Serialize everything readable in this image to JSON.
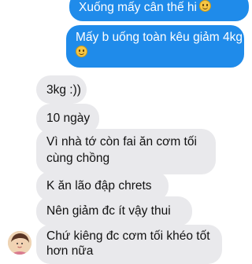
{
  "messages": [
    {
      "side": "out",
      "text": "Xuống mấy cân thế hi",
      "emoji": "grinning-face-icon"
    },
    {
      "side": "out",
      "line1": "Mấy b uống toàn kêu giảm 4kg",
      "emoji": "grinning-face-icon"
    },
    {
      "side": "in",
      "text": "3kg :))"
    },
    {
      "side": "in",
      "text": "10 ngày"
    },
    {
      "side": "in",
      "line1": "Vì nhà tớ còn fai ăn cơm tối",
      "line2": "cùng chồng"
    },
    {
      "side": "in",
      "text": "K ăn lão đập chrets"
    },
    {
      "side": "in",
      "text": "Nên giảm đc ít vậy thui"
    },
    {
      "side": "in",
      "line1": "Chứ kiêng đc cơm tối khéo tốt",
      "line2": "hơn nữa"
    }
  ],
  "colors": {
    "outgoing_bubble": "#1f8bea",
    "incoming_bubble": "#e9e9ec"
  }
}
